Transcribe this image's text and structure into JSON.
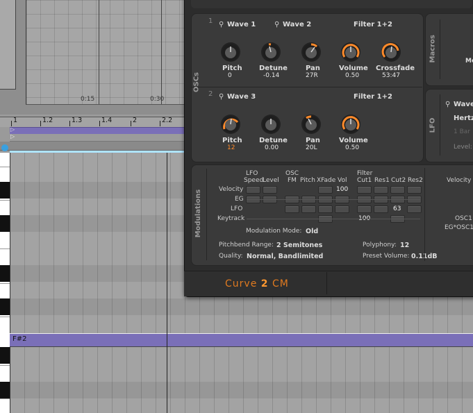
{
  "arrangement": {
    "top_timeline_labels": [
      "0:15",
      "0:30"
    ],
    "ruler_marks": [
      "1",
      "1.2",
      "1.3",
      "1.4",
      "2",
      "2.2"
    ],
    "note_label": "F#2"
  },
  "plugin": {
    "oscs": {
      "section_label": "OSCs",
      "osc1": {
        "number": "1",
        "wave1_label": "Wave 1",
        "wave2_label": "Wave 2",
        "filter_label": "Filter 1+2",
        "knobs": [
          {
            "name": "Pitch",
            "value": "0"
          },
          {
            "name": "Detune",
            "value": "-0.14"
          },
          {
            "name": "Pan",
            "value": "27R"
          },
          {
            "name": "Volume",
            "value": "0.50"
          },
          {
            "name": "Crossfade",
            "value": "53:47"
          }
        ]
      },
      "osc2": {
        "number": "2",
        "wave3_label": "Wave 3",
        "filter_label": "Filter 1+2",
        "knobs": [
          {
            "name": "Pitch",
            "value": "12"
          },
          {
            "name": "Detune",
            "value": "0.00"
          },
          {
            "name": "Pan",
            "value": "20L"
          },
          {
            "name": "Volume",
            "value": "0.50"
          }
        ]
      }
    },
    "macros": {
      "label": "Macros",
      "partial_text": "Me"
    },
    "lfo": {
      "label": "LFO",
      "wave_label": "Wave",
      "rate_mode": "Hertz",
      "bar_text": "1 Bar",
      "level_label": "Level:"
    },
    "modulations": {
      "section_label": "Modulations",
      "group_headers": [
        "LFO",
        "OSC",
        "Filter"
      ],
      "column_headers": [
        "Speed",
        "Level",
        "FM",
        "Pitch",
        "XFade",
        "Vol",
        "Cut1",
        "Res1",
        "Cut2",
        "Res2"
      ],
      "rows": [
        "Velocity",
        "EG",
        "LFO",
        "Keytrack"
      ],
      "values": {
        "velocity_vol": "100",
        "lfo_cut2": "63",
        "keytrack_cut1": "100"
      },
      "mode_label": "Modulation Mode:",
      "mode_value": "Old",
      "pitchbend_label": "Pitchbend Range:",
      "pitchbend_value": "2 Semitones",
      "polyphony_label": "Polyphony:",
      "polyphony_value": "12",
      "quality_label": "Quality:",
      "quality_value": "Normal, Bandlimited",
      "preset_volume_label": "Preset Volume:",
      "preset_volume_value": "0.11dB",
      "right_labels": [
        "Velocity",
        "OSC1",
        "EG*OSC1"
      ]
    },
    "brand": {
      "prefix": "Curve",
      "number": "2",
      "suffix": "CM"
    },
    "colors": {
      "accent": "#ff8a2a",
      "clip": "#7a6fb8",
      "panel": "#3a3a3a"
    }
  }
}
